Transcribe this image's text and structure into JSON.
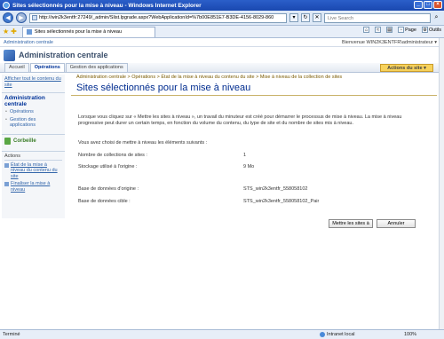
{
  "window": {
    "title": "Sites sélectionnés pour la mise à niveau - Windows Internet Explorer",
    "minimize": "_",
    "maximize": "□",
    "close": "×"
  },
  "addressbar": {
    "url": "http://win2k3entfr:27249/_admin/Slist.lpgrade.aspx?WebApplicationId=%7b00E851E7-B3DE-4156-8029-860",
    "search_placeholder": "Live Search",
    "back_icon": "◀",
    "forward_icon": "▶",
    "search_icon": "⌕"
  },
  "tabs": {
    "current_tab": "Sites sélectionnés pour la mise à niveau",
    "commands": {
      "page": "Page",
      "tools": "Outils"
    }
  },
  "sharepoint": {
    "top_link": "Administration centrale",
    "welcome": "Bienvenue WIN2K3ENTFR\\administrateur ▾",
    "help_icon": "?",
    "site_title": "Administration centrale",
    "nav_tabs": [
      "Accueil",
      "Opérations",
      "Gestion des applications"
    ],
    "active_tab": "Opérations",
    "site_actions": "Actions du site ▾"
  },
  "leftnav": {
    "view_all": "Afficher tout le contenu du site",
    "section_title": "Administration centrale",
    "links": [
      "Opérations",
      "Gestion des applications"
    ],
    "recycle_bin": "Corbeille",
    "actions_title": "Actions",
    "action_links": [
      "État de la mise à niveau du contenu du site",
      "Finaliser la mise à niveau"
    ]
  },
  "main": {
    "breadcrumb": "Administration centrale > Opérations > État de la mise à niveau du contenu du site > Mise à niveau de la collection de sites",
    "title": "Sites sélectionnés pour la mise à niveau",
    "description": "Lorsque vous cliquez sur « Mettre les sites à niveau », un travail du minuteur est créé pour démarrer le processus de mise à niveau. La mise à niveau progressive peut durer un certain temps, en fonction du volume du contenu, du type de site et du nombre de sites mis à niveau.",
    "chosen_label": "Vous avez choisi de mettre à niveau les éléments suivants :",
    "fields": [
      {
        "label": "Nombre de collections de sites :",
        "value": "1"
      },
      {
        "label": "Stockage utilisé à l'origine :",
        "value": "9 Mo"
      },
      {
        "label": "Base de données d'origine :",
        "value": "STS_win2k3entfr_558058102"
      },
      {
        "label": "Base de données cible :",
        "value": "STS_win2k3entfr_558058102_Pair"
      }
    ],
    "upgrade_button": "Mettre les sites à",
    "cancel_button": "Annuler"
  },
  "statusbar": {
    "status": "Terminé",
    "zone": "Intranet local",
    "zoom": "100%"
  }
}
